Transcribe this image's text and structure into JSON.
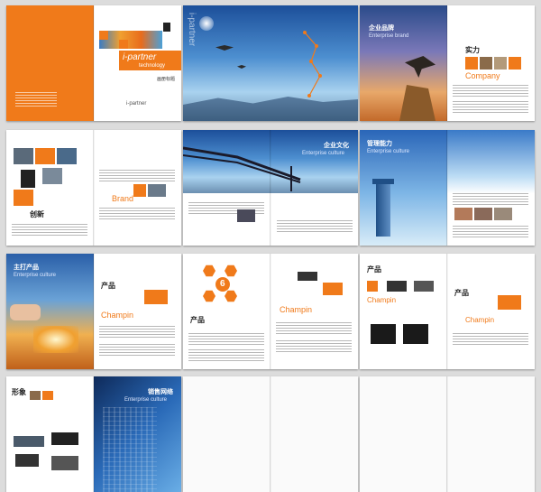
{
  "colors": {
    "accent": "#f07a1a",
    "sky": "#3f86cf",
    "background": "#dcdcdc"
  },
  "brand": {
    "name": "i-partner",
    "tagline": "technology",
    "logo_text": "i-partner"
  },
  "cover": {
    "corner_text": "画册标题"
  },
  "spread2": {
    "vertical_text": "i-partner"
  },
  "spread3": {
    "heading_cn": "企业品牌",
    "heading_en": "Enterprise brand",
    "title_cn": "实力",
    "title_en": "Company"
  },
  "spread4": {
    "title_cn": "创新",
    "title_en": "Brand"
  },
  "spread5": {
    "heading_cn": "企业文化",
    "heading_en": "Enterprise culture"
  },
  "spread6": {
    "heading_cn": "管理能力",
    "heading_en": "Enterprise culture"
  },
  "spread7": {
    "heading_cn": "主打产品",
    "heading_en": "Enterprise culture",
    "title_cn": "产品",
    "title_en": "Champin"
  },
  "spread8": {
    "title_cn": "产品",
    "title_en": "Champin",
    "badge_number": "6"
  },
  "spread9": {
    "title_cn": "产品",
    "title_en": "Champin"
  },
  "spread10": {
    "title_cn": "形象",
    "heading_cn": "销售网络",
    "heading_en": "Enterprise culture"
  }
}
